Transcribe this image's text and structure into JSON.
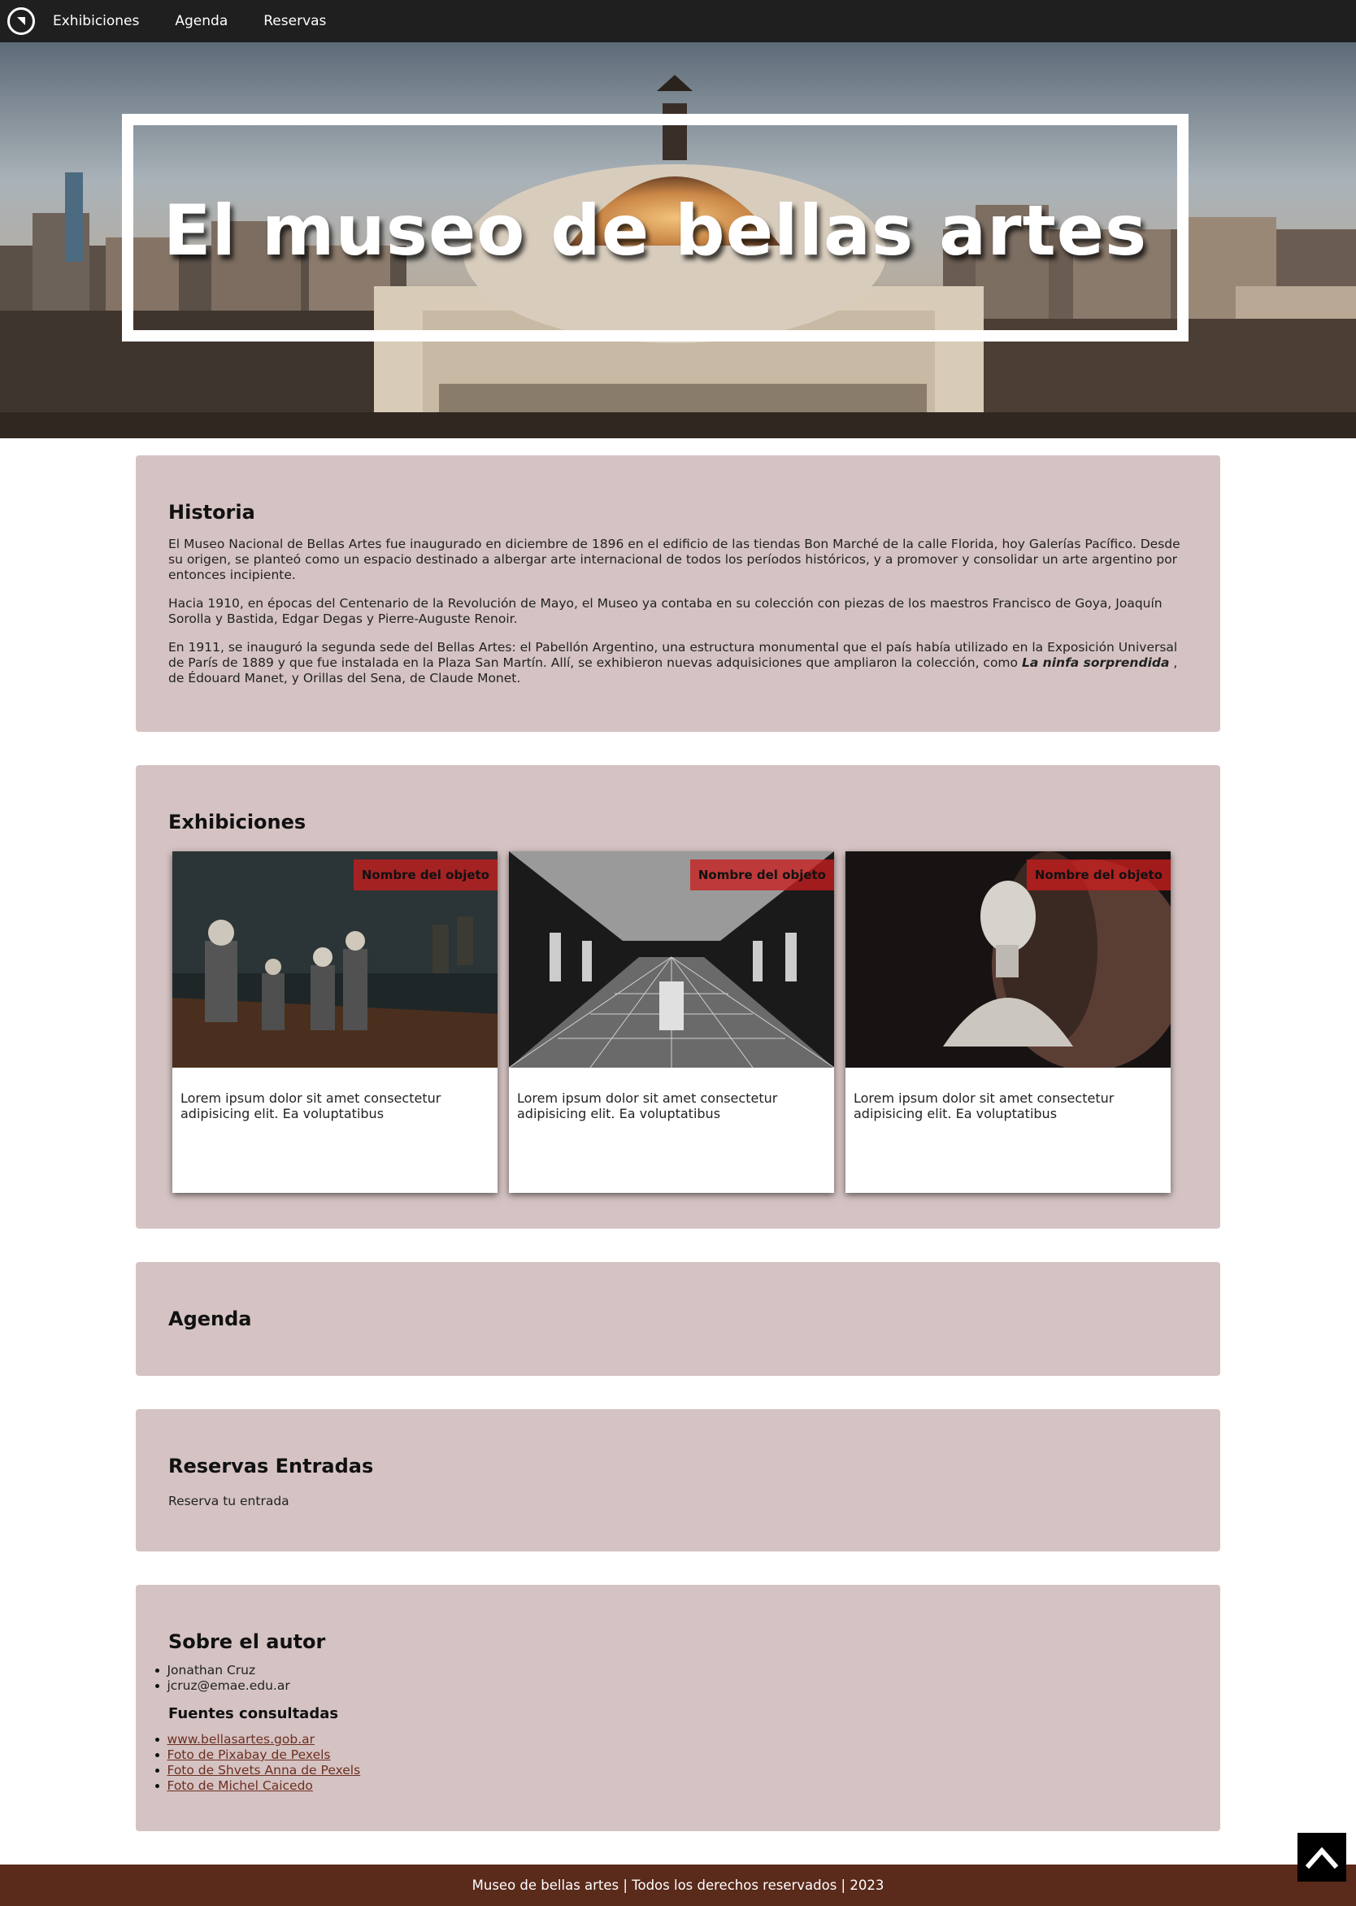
{
  "nav": {
    "items": [
      "Exhibiciones",
      "Agenda",
      "Reservas"
    ]
  },
  "hero": {
    "title": "El museo de bellas artes"
  },
  "historia": {
    "heading": "Historia",
    "p1": "El Museo Nacional de Bellas Artes fue inaugurado en diciembre de 1896 en el edificio de las tiendas Bon Marché de la calle Florida, hoy Galerías Pacífico. Desde su origen, se planteó como un espacio destinado a albergar arte internacional de todos los períodos históricos, y a promover y consolidar un arte argentino por entonces incipiente.",
    "p2": "Hacia 1910, en épocas del Centenario de la Revolución de Mayo, el Museo ya contaba en su colección con piezas de los maestros Francisco de Goya, Joaquín Sorolla y Bastida, Edgar Degas y Pierre-Auguste Renoir.",
    "p3_start": "En 1911, se inauguró la segunda sede del Bellas Artes: el Pabellón Argentino, una estructura monumental que el país había utilizado en la Exposición Universal de París de 1889 y que fue instalada en la Plaza San Martín. Allí, se exhibieron nuevas adquisiciones que ampliaron la colección, como ",
    "p3_em": "La ninfa sorprendida",
    "p3_end": " , de Édouard Manet, y Orillas del Sena, de Claude Monet."
  },
  "exhibiciones": {
    "heading": "Exhibiciones",
    "cards": [
      {
        "tag": "Nombre del objeto",
        "text": "Lorem ipsum dolor sit amet consectetur adipisicing elit. Ea voluptatibus"
      },
      {
        "tag": "Nombre del objeto",
        "text": "Lorem ipsum dolor sit amet consectetur adipisicing elit. Ea voluptatibus"
      },
      {
        "tag": "Nombre del objeto",
        "text": "Lorem ipsum dolor sit amet consectetur adipisicing elit. Ea voluptatibus"
      }
    ]
  },
  "agenda": {
    "heading": "Agenda"
  },
  "reservas": {
    "heading": "Reservas Entradas",
    "text": "Reserva tu entrada"
  },
  "autor": {
    "heading": "Sobre el autor",
    "info": [
      "Jonathan Cruz",
      "jcruz@emae.edu.ar"
    ],
    "sources_heading": "Fuentes consultadas",
    "sources": [
      "www.bellasartes.gob.ar",
      "Foto de Pixabay de Pexels",
      "Foto de Shvets Anna de Pexels",
      "Foto de Michel Caicedo"
    ]
  },
  "footer": {
    "text": "Museo de bellas artes | Todos los derechos reservados | 2023"
  },
  "colors": {
    "nav_bg": "#1f1f1f",
    "section_bg": "#d5c3c3",
    "tag_bg": "#c81e1e",
    "footer_bg": "#5a2a1b",
    "link": "#6d2e20"
  },
  "icons": [
    "logo-icon",
    "chevron-up-icon"
  ]
}
